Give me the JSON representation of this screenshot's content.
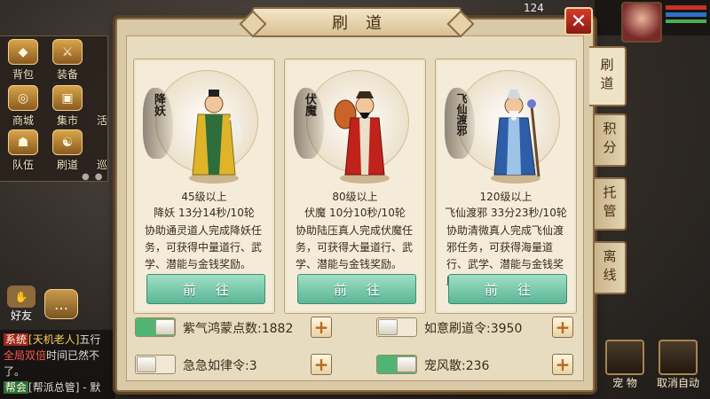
{
  "hud": {
    "level": "124",
    "level2": "124"
  },
  "left_menu": [
    {
      "label": "背包",
      "icon": "bag-icon"
    },
    {
      "label": "装备",
      "icon": "equipment-icon"
    },
    {
      "label": "商城",
      "icon": "mall-icon"
    },
    {
      "label": "集市",
      "icon": "market-icon"
    },
    {
      "label": "队伍",
      "icon": "team-icon"
    },
    {
      "label": "刷道",
      "icon": "daoist-icon"
    }
  ],
  "left_menu_partial": [
    "活",
    "巡"
  ],
  "social": {
    "friends": "好友",
    "chat_icon": "chat-bubble-icon"
  },
  "chat": {
    "line1_tag": "系统",
    "line1_name": "[天机老人]",
    "line1_text": "五行",
    "line2_red": "全局双倍",
    "line2_text": "时间已然不",
    "line3_text": "了。",
    "line4_tag": "帮会",
    "line4_text": "[帮派总管] - 默"
  },
  "dialog": {
    "title": "刷道",
    "close_label": "✕",
    "cards": [
      {
        "tag": "降妖",
        "level": "45级以上",
        "timer": "降妖 13分14秒/10轮",
        "desc": "协助通灵道人完成降妖任务，可获得中量道行、武学、潜能与金钱奖励。",
        "button": "前往"
      },
      {
        "tag": "伏魔",
        "level": "80级以上",
        "timer": "伏魔 10分10秒/10轮",
        "desc": "协助陆压真人完成伏魔任务，可获得大量道行、武学、潜能与金钱奖励。",
        "button": "前往"
      },
      {
        "tag": "飞仙渡邪",
        "level": "120级以上",
        "timer": "飞仙渡邪 33分23秒/10轮",
        "desc": "协助清微真人完成飞仙渡邪任务，可获得海量道行、武学、潜能与金钱奖励。",
        "button": "前往"
      }
    ],
    "tabs": [
      "刷道",
      "积分",
      "托管",
      "离线"
    ],
    "items": [
      {
        "label": "紫气鸿蒙点数:1882",
        "on": true
      },
      {
        "label": "如意刷道令:3950",
        "on": false
      },
      {
        "label": "急急如律令:3",
        "on": false
      },
      {
        "label": "宠风散:236",
        "on": true
      }
    ],
    "plus_label": "+"
  },
  "bottom_right": {
    "pet": "宠 物",
    "cancel_auto": "取消自动"
  },
  "colors": {
    "toggle_on": "#4fb474",
    "go_button": "#6cc2a2",
    "close": "#c8302a"
  }
}
